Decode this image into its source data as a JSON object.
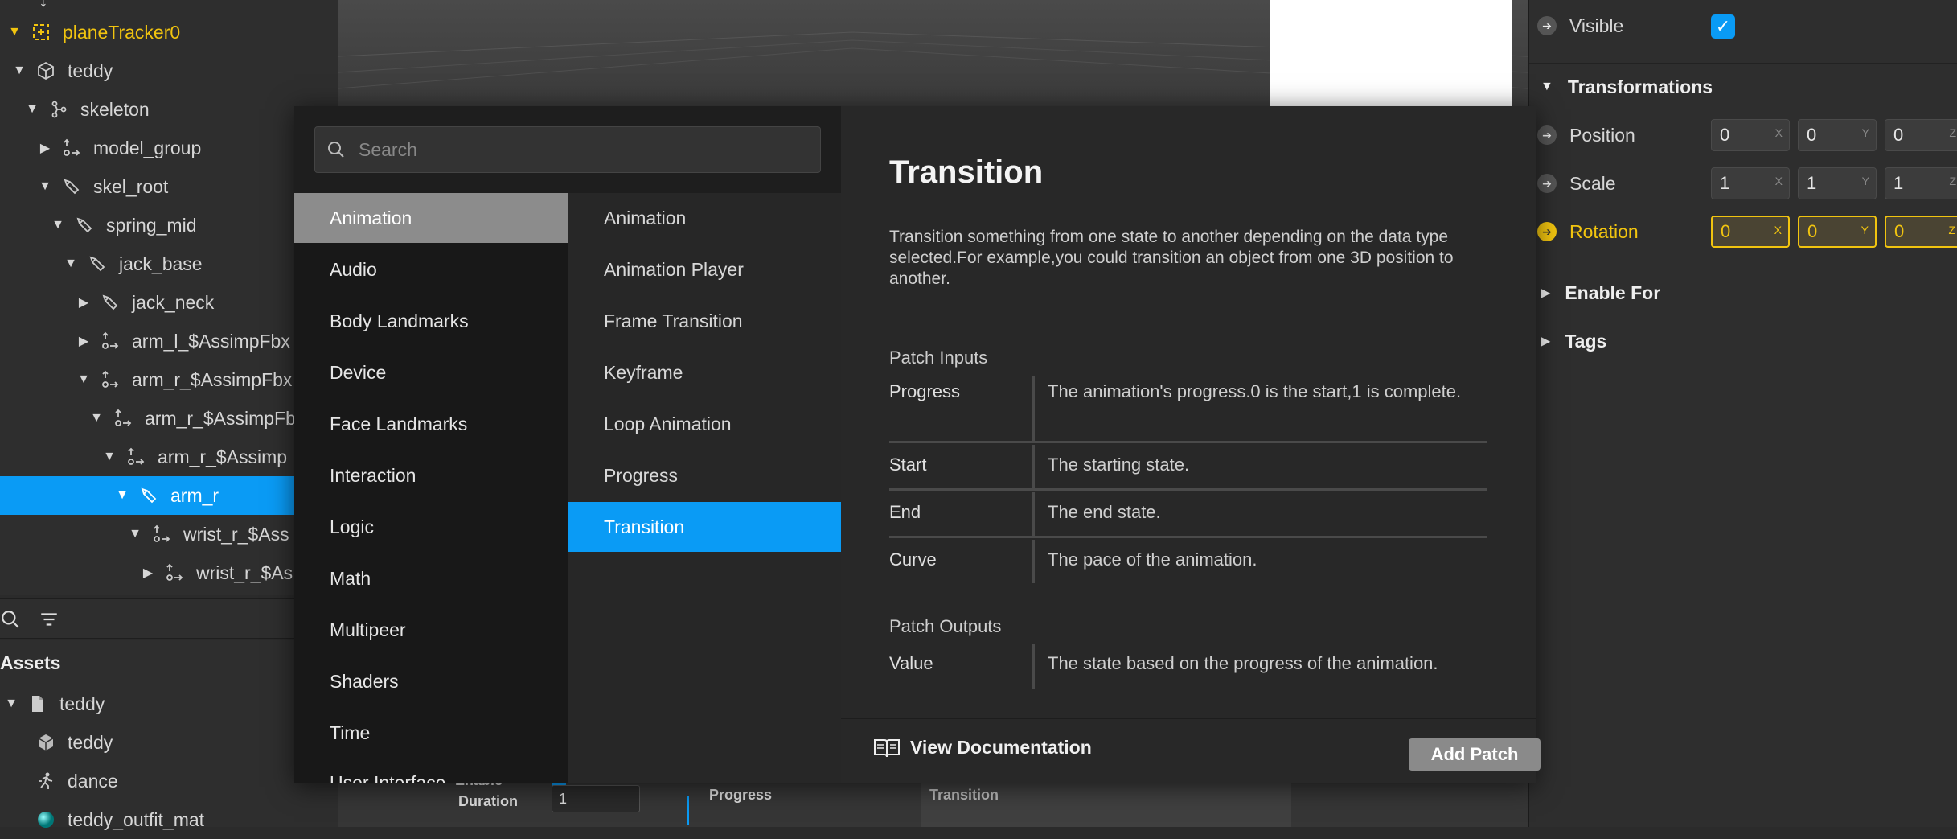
{
  "scene_tree": {
    "items": [
      {
        "label": "planeTracker0",
        "icon": "plane-tracker-icon"
      },
      {
        "label": "teddy",
        "icon": "cube-icon"
      },
      {
        "label": "skeleton",
        "icon": "skeleton-icon"
      },
      {
        "label": "model_group",
        "icon": "null-object-icon"
      },
      {
        "label": "skel_root",
        "icon": "bone-icon"
      },
      {
        "label": "spring_mid",
        "icon": "bone-icon"
      },
      {
        "label": "jack_base",
        "icon": "bone-icon"
      },
      {
        "label": "jack_neck",
        "icon": "bone-icon"
      },
      {
        "label": "arm_l_$AssimpFbx",
        "icon": "null-object-icon"
      },
      {
        "label": "arm_r_$AssimpFbx",
        "icon": "null-object-icon"
      },
      {
        "label": "arm_r_$AssimpFb",
        "icon": "null-object-icon"
      },
      {
        "label": "arm_r_$Assimp",
        "icon": "null-object-icon"
      },
      {
        "label": "arm_r",
        "icon": "bone-icon"
      },
      {
        "label": "wrist_r_$Ass",
        "icon": "null-object-icon"
      },
      {
        "label": "wrist_r_$As",
        "icon": "null-object-icon"
      }
    ]
  },
  "assets": {
    "title": "Assets",
    "items": [
      {
        "label": "teddy",
        "icon": "file-icon"
      },
      {
        "label": "teddy",
        "icon": "cube-icon"
      },
      {
        "label": "dance",
        "icon": "animation-icon"
      },
      {
        "label": "teddy_outfit_mat",
        "icon": "material-icon"
      }
    ]
  },
  "inspector": {
    "visible_label": "Visible",
    "visible_checked": true,
    "transformations_title": "Transformations",
    "position_label": "Position",
    "position": [
      "0",
      "0",
      "0"
    ],
    "scale_label": "Scale",
    "scale": [
      "1",
      "1",
      "1"
    ],
    "rotation_label": "Rotation",
    "rotation": [
      "0",
      "0",
      "0"
    ],
    "axes": [
      "X",
      "Y",
      "Z"
    ],
    "enable_for_label": "Enable For",
    "tags_label": "Tags",
    "accent_color": "#f1c40f"
  },
  "patch_graph": {
    "enable_label": "Enable",
    "duration_label": "Duration",
    "duration_value": "1",
    "progress_label": "Progress",
    "transition_label": "Transition"
  },
  "modal": {
    "search_placeholder": "Search",
    "categories": [
      "Animation",
      "Audio",
      "Body Landmarks",
      "Device",
      "Face Landmarks",
      "Interaction",
      "Logic",
      "Math",
      "Multipeer",
      "Shaders",
      "Time",
      "User Interface"
    ],
    "active_category": "Animation",
    "patches": [
      "Animation",
      "Animation Player",
      "Frame Transition",
      "Keyframe",
      "Loop Animation",
      "Progress",
      "Transition"
    ],
    "active_patch": "Transition",
    "doc": {
      "title": "Transition",
      "description": "Transition something from one state to another depending on the data type selected.For example,you could transition an object from one 3D position to another.",
      "inputs_label": "Patch Inputs",
      "inputs": [
        {
          "name": "Progress",
          "desc": "The animation's progress.0 is the start,1 is complete."
        },
        {
          "name": "Start",
          "desc": "The starting state."
        },
        {
          "name": "End",
          "desc": "The end state."
        },
        {
          "name": "Curve",
          "desc": "The pace of the animation."
        }
      ],
      "outputs_label": "Patch Outputs",
      "outputs": [
        {
          "name": "Value",
          "desc": "The state based on the progress of the animation."
        }
      ]
    },
    "view_documentation_label": "View Documentation",
    "add_patch_label": "Add Patch",
    "selection_color": "#0a9bf5"
  }
}
